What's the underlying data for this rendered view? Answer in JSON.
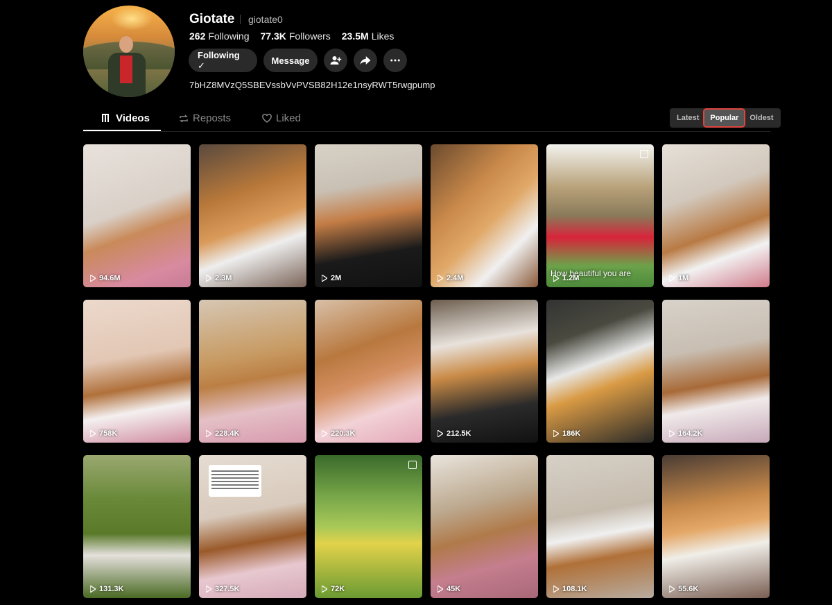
{
  "profile": {
    "name": "Giotate",
    "handle": "giotate0",
    "following_count": "262",
    "following_label": "Following",
    "followers_count": "77.3K",
    "followers_label": "Followers",
    "likes_count": "23.5M",
    "likes_label": "Likes",
    "bio": "7bHZ8MVzQ5SBEVssbVvPVSB82H12e1nsyRWT5rwgpump"
  },
  "actions": {
    "following_button": "Following ✓",
    "message_button": "Message",
    "add_friend_icon": "add-friend-icon",
    "share_icon": "share-icon",
    "more_icon": "more-icon"
  },
  "tabs": [
    {
      "label": "Videos",
      "icon": "grid-icon",
      "active": true
    },
    {
      "label": "Reposts",
      "icon": "repost-icon",
      "active": false
    },
    {
      "label": "Liked",
      "icon": "heart-outline-icon",
      "active": false
    }
  ],
  "sort": [
    {
      "label": "Latest",
      "active": false
    },
    {
      "label": "Popular",
      "active": true
    },
    {
      "label": "Oldest",
      "active": false
    }
  ],
  "videos": [
    {
      "views": "94.6M",
      "bg": "linear-gradient(160deg,#e8e2dc 0%,#d9d0c8 45%,#c98a5a 60%,#d88aa0 85%,#c77b96 100%)"
    },
    {
      "views": "2.3M",
      "bg": "linear-gradient(160deg,#5a4a3e 0%,#b9793a 35%,#d99a5a 55%,#eee 70%,#7a6458 100%)"
    },
    {
      "views": "2M",
      "bg": "linear-gradient(170deg,#d8d2c6 0%,#c9c0b4 30%,#c47d46 50%,#1a1a1a 75%,#111 100%)"
    },
    {
      "views": "2.4M",
      "bg": "linear-gradient(135deg,#6b4a2e 0%,#c9894a 35%,#e0a868 55%,#f0f0f0 75%,#8a5a3a 100%)"
    },
    {
      "views": "1.2M",
      "bg": "linear-gradient(180deg,#f2f2ee 0%,#b8a27a 30%,#8a7a5a 50%,#d8243a 65%,#6ca24a 85%,#4c8a3a 100%)",
      "caption": "How beautiful you are",
      "multi": true
    },
    {
      "views": "1M",
      "bg": "linear-gradient(160deg,#e6e0d8 0%,#d2c8bc 35%,#b87a44 60%,#f2f2f2 75%,#d07a8a 100%)"
    },
    {
      "views": "758K",
      "bg": "linear-gradient(170deg,#ecd9cc 0%,#e2c7b4 40%,#b0703a 60%,#f4f0f0 75%,#d08aa0 100%)"
    },
    {
      "views": "228.4K",
      "bg": "linear-gradient(170deg,#d6c7b4 0%,#c79a62 40%,#bb7f44 55%,#e4c0c6 75%,#d89aae 100%)"
    },
    {
      "views": "220.3K",
      "bg": "linear-gradient(160deg,#d8c0a8 0%,#b8783e 35%,#d49062 55%,#f2d2d6 75%,#e4a8b8 100%)"
    },
    {
      "views": "212.5K",
      "bg": "linear-gradient(170deg,#6c5e4e 0%,#e8e2dc 30%,#c98a46 50%,#2a2a2a 75%,#111 100%)"
    },
    {
      "views": "186K",
      "bg": "linear-gradient(160deg,#333 0%,#4a4a40 25%,#e8e8e8 45%,#d99a44 60%,#2a2a28 100%)"
    },
    {
      "views": "164.2K",
      "bg": "linear-gradient(170deg,#d8d2ca 0%,#c8beb2 35%,#a86a38 58%,#f0eaea 72%,#c7a8b8 100%)"
    },
    {
      "views": "131.3K",
      "bg": "linear-gradient(180deg,#9aa870 0%,#6a8a3a 30%,#5a7a2a 55%,#e4e0dc 70%,#4a6a22 100%)"
    },
    {
      "views": "327.5K",
      "bg": "linear-gradient(170deg,#e6dcd2 0%,#d8cabc 40%,#9a5a2a 60%,#e8c8d0 78%,#d4aab8 100%)",
      "note": true
    },
    {
      "views": "72K",
      "bg": "linear-gradient(180deg,#3a6a2a 0%,#7aa84a 30%,#a8c858 50%,#e2d24a 62%,#6a9a32 100%)",
      "multi": true
    },
    {
      "views": "45K",
      "bg": "linear-gradient(165deg,#e8e4dc 0%,#bca88e 35%,#b07a4a 55%,#c47e8e 75%,#a86878 100%)"
    },
    {
      "views": "108.1K",
      "bg": "linear-gradient(170deg,#d6d0c6 0%,#c6bcae 40%,#f0f0f0 55%,#b07038 70%,#b8aca0 100%)"
    },
    {
      "views": "55.6K",
      "bg": "linear-gradient(170deg,#4a3c34 0%,#c88a4a 35%,#e4a868 50%,#f0eee8 65%,#7a5e52 100%)"
    }
  ]
}
